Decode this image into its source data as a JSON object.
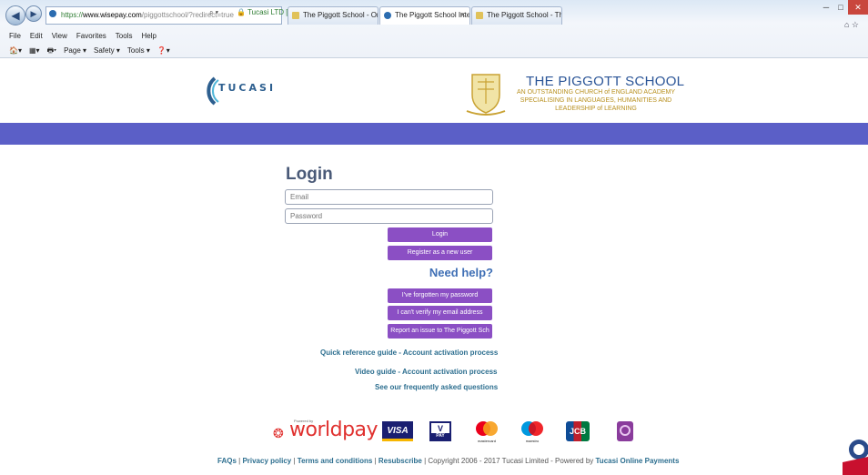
{
  "browser": {
    "address": {
      "scheme": "https://",
      "host": "www.wisepay.com",
      "path": "/piggottschool/?redirect=true"
    },
    "security_label": "Tucasi LTD [GB]",
    "tabs": [
      {
        "label": "The Piggott School - Online Pa...",
        "active": false
      },
      {
        "label": "The Piggott School Internet...",
        "active": true
      },
      {
        "label": "The Piggott School - The Pigg...",
        "active": false
      }
    ],
    "menu": [
      "File",
      "Edit",
      "View",
      "Favorites",
      "Tools",
      "Help"
    ],
    "commands": [
      "Page ▾",
      "Safety ▾",
      "Tools ▾"
    ]
  },
  "header": {
    "tucasi_logo_text": "TUCASI",
    "school_name": "THE PIGGOTT SCHOOL",
    "school_tagline": "AN OUTSTANDING CHURCH of ENGLAND ACADEMY SPECIALISING IN LANGUAGES, HUMANITIES AND LEADERSHIP of LEARNING",
    "band_color": "#5b5fc7"
  },
  "login": {
    "title": "Login",
    "email_placeholder": "Email",
    "password_placeholder": "Password",
    "login_button": "Login",
    "register_button": "Register as a new user"
  },
  "help": {
    "title": "Need help?",
    "forgot_password": "I've forgotten my password",
    "cant_verify": "I can't verify my email address",
    "report_issue": "Report an issue to The Piggott Sch"
  },
  "guides": {
    "quick_reference": "Quick reference guide - Account activation process",
    "video_guide": "Video guide - Account activation process",
    "faq_link": "See our frequently asked questions"
  },
  "payments": {
    "worldpay": "worldpay",
    "powered_by": "Powered by",
    "visa": "VISA",
    "vpay_v": "V",
    "vpay_pay": "PAY",
    "mastercard": "mastercard",
    "maestro": "maestro",
    "jcb": "JCB"
  },
  "footer": {
    "faqs": "FAQs",
    "privacy": "Privacy policy",
    "terms": "Terms and conditions",
    "resubscribe": "Resubscribe",
    "copyright": "Copyright 2006 - 2017 Tucasi Limited - Powered by",
    "tucasi_online_payments": "Tucasi Online Payments",
    "sep": " | "
  },
  "colors": {
    "purple_button": "#8b4fc4",
    "band": "#5b5fc7",
    "link": "#2c6e8f",
    "help_blue": "#3f6fb5"
  }
}
